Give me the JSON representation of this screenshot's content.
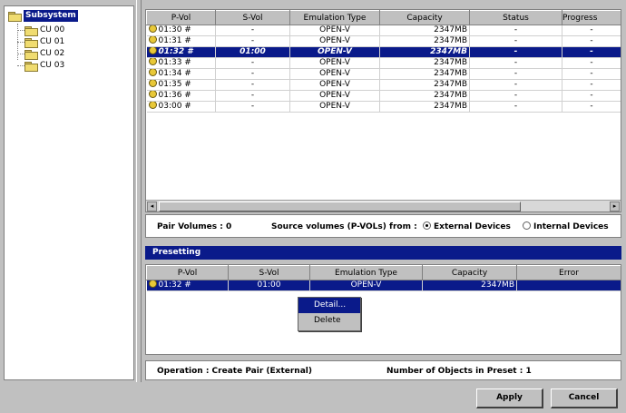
{
  "tree": {
    "root": "Subsystem",
    "children": [
      "CU 00",
      "CU 01",
      "CU 02",
      "CU 03"
    ]
  },
  "upper_table": {
    "columns": [
      "P-Vol",
      "S-Vol",
      "Emulation Type",
      "Capacity",
      "Status",
      "Progress"
    ],
    "rows": [
      {
        "pvol": "01:30 #",
        "svol": "-",
        "emu": "OPEN-V",
        "cap": "2347MB",
        "status": "-",
        "prog": "-"
      },
      {
        "pvol": "01:31 #",
        "svol": "-",
        "emu": "OPEN-V",
        "cap": "2347MB",
        "status": "-",
        "prog": "-"
      },
      {
        "pvol": "01:32 #",
        "svol": "01:00",
        "emu": "OPEN-V",
        "cap": "2347MB",
        "status": "-",
        "prog": "-"
      },
      {
        "pvol": "01:33 #",
        "svol": "-",
        "emu": "OPEN-V",
        "cap": "2347MB",
        "status": "-",
        "prog": "-"
      },
      {
        "pvol": "01:34 #",
        "svol": "-",
        "emu": "OPEN-V",
        "cap": "2347MB",
        "status": "-",
        "prog": "-"
      },
      {
        "pvol": "01:35 #",
        "svol": "-",
        "emu": "OPEN-V",
        "cap": "2347MB",
        "status": "-",
        "prog": "-"
      },
      {
        "pvol": "01:36 #",
        "svol": "-",
        "emu": "OPEN-V",
        "cap": "2347MB",
        "status": "-",
        "prog": "-"
      },
      {
        "pvol": "03:00 #",
        "svol": "-",
        "emu": "OPEN-V",
        "cap": "2347MB",
        "status": "-",
        "prog": "-"
      }
    ],
    "selected_index": 2
  },
  "pairbar": {
    "pair_volumes": "Pair Volumes : 0",
    "source_label": "Source volumes (P-VOLs) from :",
    "external": "External Devices",
    "internal": "Internal Devices"
  },
  "preset": {
    "title": "Presetting",
    "columns": [
      "P-Vol",
      "S-Vol",
      "Emulation Type",
      "Capacity",
      "Error"
    ],
    "row": {
      "pvol": "01:32 #",
      "svol": "01:00",
      "emu": "OPEN-V",
      "cap": "2347MB",
      "err": ""
    }
  },
  "context_menu": [
    "Detail...",
    "Delete"
  ],
  "opbar": {
    "operation": "Operation : Create Pair (External)",
    "count": "Number of Objects in Preset : 1"
  },
  "buttons": {
    "apply": "Apply",
    "cancel": "Cancel"
  },
  "colors": {
    "selection": "#0a1a8a",
    "panel": "#c0c0c0"
  }
}
